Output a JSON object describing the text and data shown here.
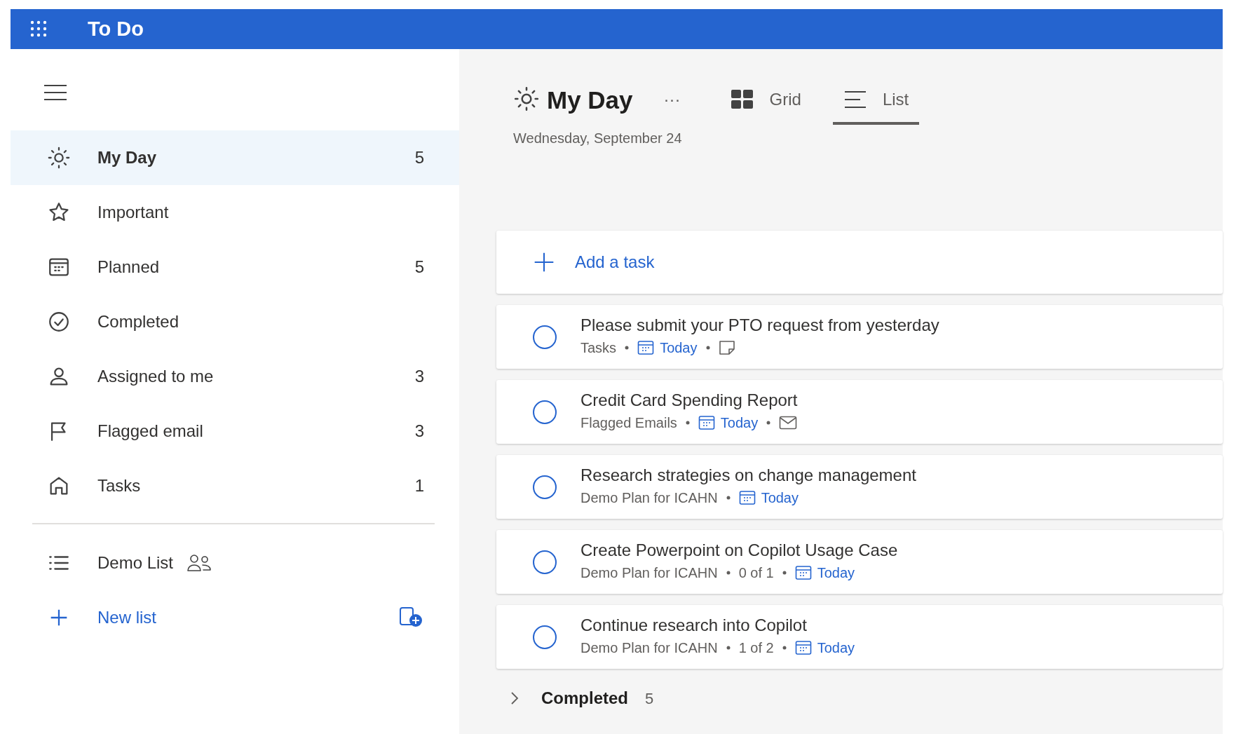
{
  "app": {
    "title": "To Do"
  },
  "sidebar": {
    "items": [
      {
        "kind": "sun",
        "label": "My Day",
        "count": "5",
        "selected": true
      },
      {
        "kind": "star",
        "label": "Important",
        "selected": false
      },
      {
        "kind": "calendar",
        "label": "Planned",
        "count": "5",
        "selected": false
      },
      {
        "kind": "check",
        "label": "Completed",
        "selected": false
      },
      {
        "kind": "person",
        "label": "Assigned to me",
        "count": "3",
        "selected": false
      },
      {
        "kind": "flag",
        "label": "Flagged email",
        "count": "3",
        "selected": false
      },
      {
        "kind": "home",
        "label": "Tasks",
        "count": "1",
        "selected": false
      }
    ],
    "lists": [
      {
        "label": "Demo List",
        "shared": true
      }
    ],
    "new_list": "New list"
  },
  "header": {
    "title": "My Day",
    "more": "···",
    "date": "Wednesday, September 24",
    "views": [
      {
        "kind": "grid",
        "label": "Grid",
        "selected": false
      },
      {
        "kind": "list",
        "label": "List",
        "selected": true
      }
    ]
  },
  "add_task": "Add a task",
  "tasks": [
    {
      "completed": false,
      "title": "Please submit your PTO request from yesterday",
      "meta": [
        {
          "kind": "text",
          "text": "Tasks"
        },
        {
          "kind": "due",
          "text": "Today"
        },
        {
          "kind": "note"
        }
      ]
    },
    {
      "completed": false,
      "title": "Credit Card Spending Report",
      "meta": [
        {
          "kind": "text",
          "text": "Flagged Emails"
        },
        {
          "kind": "due",
          "text": "Today"
        },
        {
          "kind": "mail"
        }
      ]
    },
    {
      "completed": false,
      "title": "Research strategies on change management",
      "meta": [
        {
          "kind": "text",
          "text": "Demo Plan for ICAHN"
        },
        {
          "kind": "due",
          "text": "Today"
        }
      ]
    },
    {
      "completed": false,
      "title": "Create Powerpoint on Copilot Usage Case",
      "meta": [
        {
          "kind": "text",
          "text": "Demo Plan for ICAHN"
        },
        {
          "kind": "text",
          "text": "0 of 1"
        },
        {
          "kind": "due",
          "text": "Today"
        }
      ]
    },
    {
      "completed": false,
      "title": "Continue research into Copilot",
      "meta": [
        {
          "kind": "text",
          "text": "Demo Plan for ICAHN"
        },
        {
          "kind": "text",
          "text": "1 of 2"
        },
        {
          "kind": "due",
          "text": "Today"
        }
      ]
    }
  ],
  "completed": {
    "label": "Completed",
    "count": "5",
    "expanded": false
  }
}
